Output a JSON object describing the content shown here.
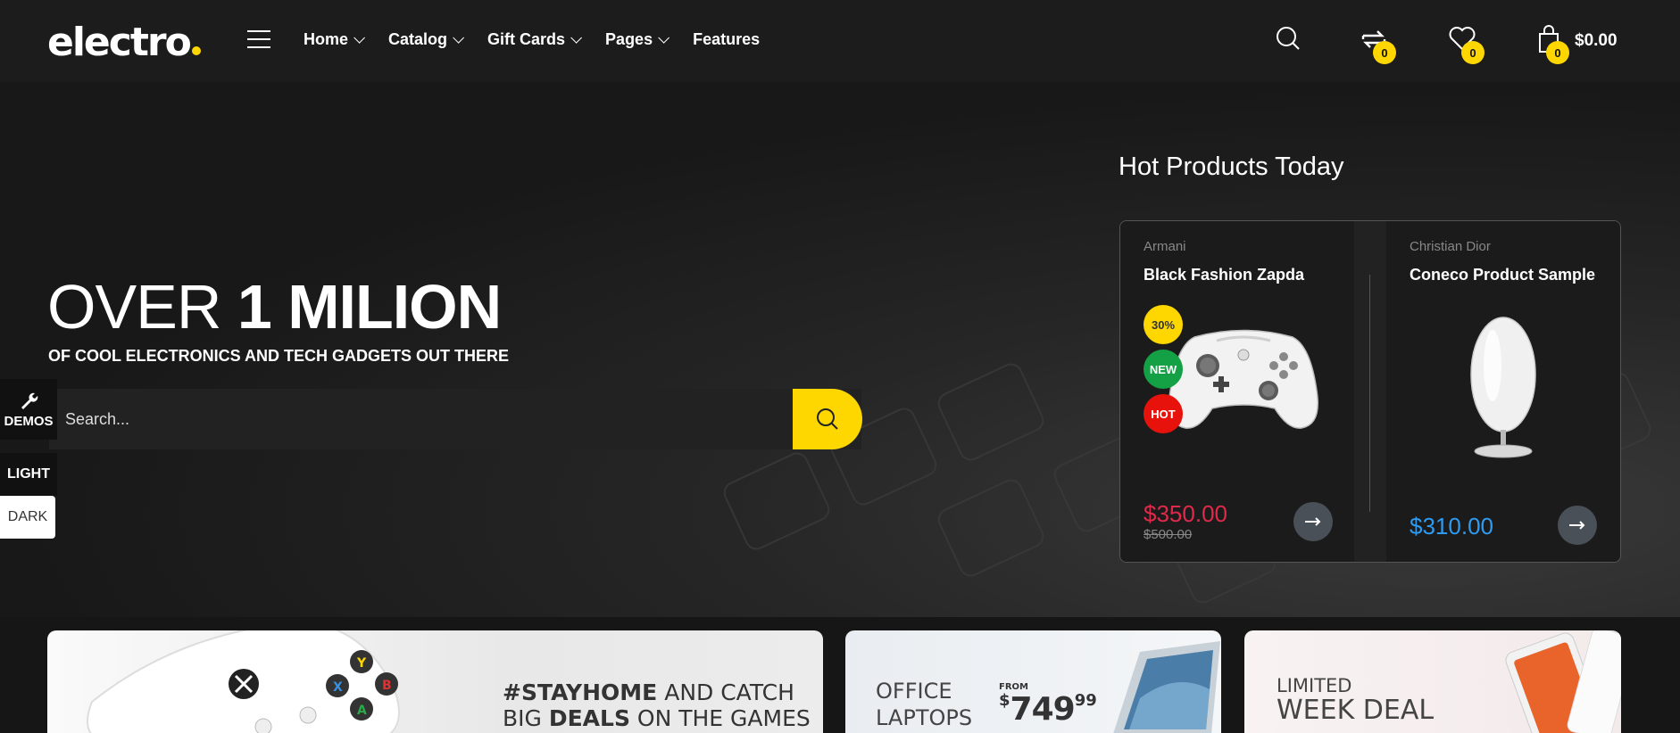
{
  "header": {
    "logo": "electro",
    "nav": [
      {
        "label": "Home",
        "has_dropdown": true
      },
      {
        "label": "Catalog",
        "has_dropdown": true
      },
      {
        "label": "Gift Cards",
        "has_dropdown": true
      },
      {
        "label": "Pages",
        "has_dropdown": true
      },
      {
        "label": "Features",
        "has_dropdown": false
      }
    ],
    "compare_count": "0",
    "wishlist_count": "0",
    "cart_count": "0",
    "cart_total": "$0.00"
  },
  "hero": {
    "title_light": "OVER ",
    "title_bold": "1 MILION",
    "subtitle": "OF COOL ELECTRONICS AND TECH GADGETS OUT THERE",
    "search_placeholder": "Search..."
  },
  "side": {
    "demos": "DEMOS",
    "light": "LIGHT",
    "dark": "DARK"
  },
  "hot_products": {
    "title": "Hot Products Today",
    "items": [
      {
        "brand": "Armani",
        "name": "Black Fashion Zapda",
        "tags": [
          "30%",
          "NEW",
          "HOT"
        ],
        "price": "$350.00",
        "old_price": "$500.00"
      },
      {
        "brand": "Christian Dior",
        "name": "Coneco Product Sample",
        "price": "$310.00"
      }
    ]
  },
  "banners": [
    {
      "hash_word": "#STAYHOME",
      "line1_rest": " AND CATCH",
      "line2_a": "BIG ",
      "line2_b": "DEALS",
      "line2_c": " ON THE GAMES"
    },
    {
      "line1": "OFFICE",
      "line2": "LAPTOPS",
      "from": "FROM",
      "price_dollar": "$",
      "price_main": "749",
      "price_cents": "99"
    },
    {
      "line1": "LIMITED",
      "line2": "WEEK DEAL"
    }
  ],
  "colors": {
    "accent": "#fed700",
    "sale_price": "#e0294b",
    "price_blue": "#2f9bf0",
    "tag_new": "#14a044",
    "tag_hot": "#e8120c"
  }
}
